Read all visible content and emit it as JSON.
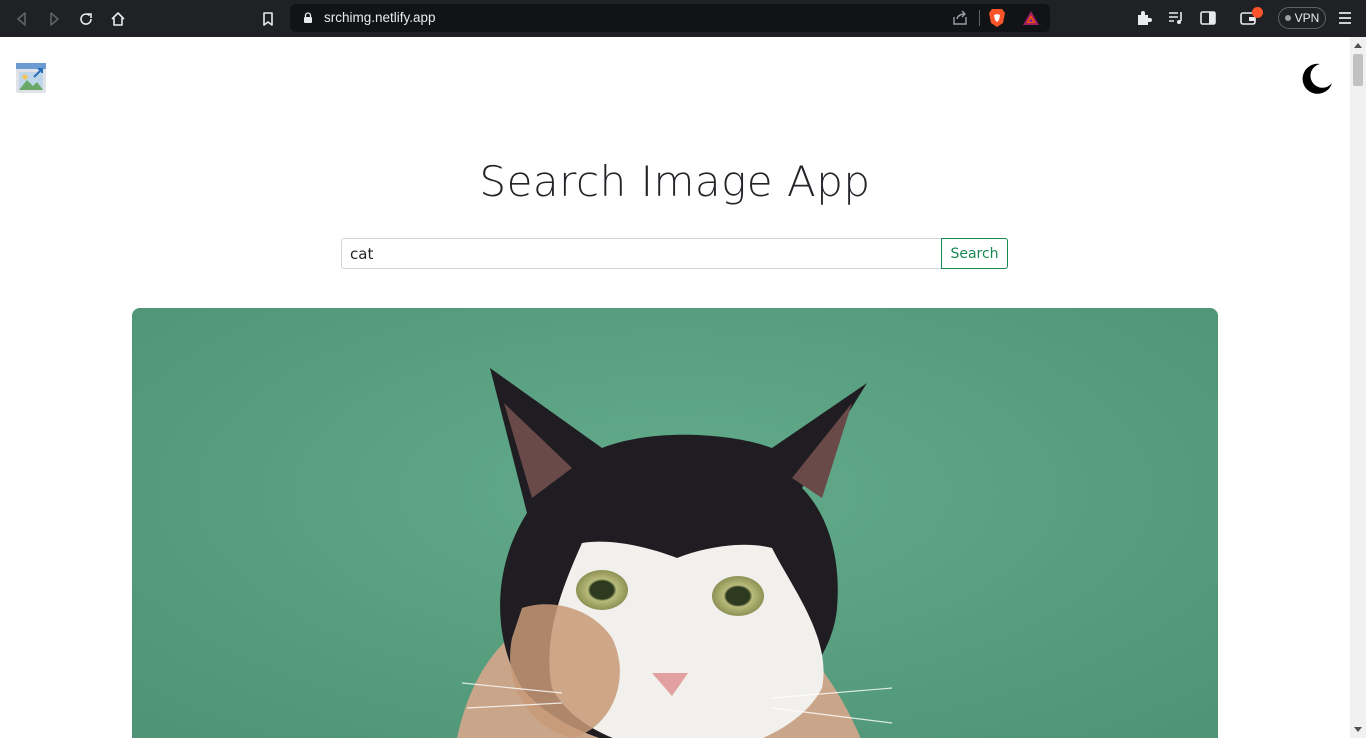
{
  "browser": {
    "url": "srchimg.netlify.app",
    "vpn_label": "VPN",
    "icons": [
      "back-icon",
      "forward-icon",
      "reload-icon",
      "home-icon",
      "bookmark-icon",
      "lock-icon",
      "share-icon",
      "brave-shield-icon",
      "brave-rewards-icon",
      "extensions-icon",
      "playlist-icon",
      "sidebar-icon",
      "wallet-icon",
      "menu-icon"
    ],
    "accent": "#fb542b"
  },
  "page": {
    "title": "Search Image App",
    "search": {
      "value": "cat",
      "button_label": "Search"
    },
    "colors": {
      "button": "#198754",
      "text": "#212529",
      "card_bg": "#5aa283"
    }
  }
}
